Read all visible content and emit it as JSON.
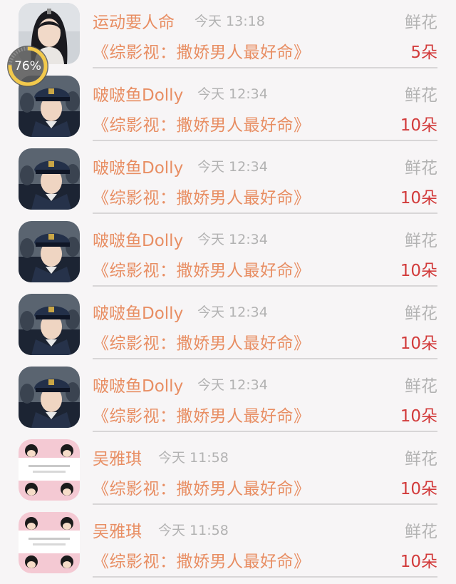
{
  "progress": {
    "label": "76%",
    "value": 0.76,
    "ring_color": "#f2c94c"
  },
  "rows": [
    {
      "name": "运动要人命",
      "time": "今天 13:18",
      "gift": "鲜花",
      "book": "《综影视：撒娇男人最好命》",
      "count": "5朵",
      "avatar": "long-hair-man"
    },
    {
      "name": "啵啵鱼Dolly",
      "time": "今天 12:34",
      "gift": "鲜花",
      "book": "《综影视：撒娇男人最好命》",
      "count": "10朵",
      "avatar": "uniform-man"
    },
    {
      "name": "啵啵鱼Dolly",
      "time": "今天 12:34",
      "gift": "鲜花",
      "book": "《综影视：撒娇男人最好命》",
      "count": "10朵",
      "avatar": "uniform-man"
    },
    {
      "name": "啵啵鱼Dolly",
      "time": "今天 12:34",
      "gift": "鲜花",
      "book": "《综影视：撒娇男人最好命》",
      "count": "10朵",
      "avatar": "uniform-man"
    },
    {
      "name": "啵啵鱼Dolly",
      "time": "今天 12:34",
      "gift": "鲜花",
      "book": "《综影视：撒娇男人最好命》",
      "count": "10朵",
      "avatar": "uniform-man"
    },
    {
      "name": "啵啵鱼Dolly",
      "time": "今天 12:34",
      "gift": "鲜花",
      "book": "《综影视：撒娇男人最好命》",
      "count": "10朵",
      "avatar": "uniform-man"
    },
    {
      "name": "吴雅琪",
      "time": "今天 11:58",
      "gift": "鲜花",
      "book": "《综影视：撒娇男人最好命》",
      "count": "10朵",
      "avatar": "cartoon-girls"
    },
    {
      "name": "吴雅琪",
      "time": "今天 11:58",
      "gift": "鲜花",
      "book": "《综影视：撒娇男人最好命》",
      "count": "10朵",
      "avatar": "cartoon-girls"
    }
  ],
  "colors": {
    "name": "#e88e63",
    "count": "#d23b3b",
    "muted": "#b3b3b3"
  }
}
